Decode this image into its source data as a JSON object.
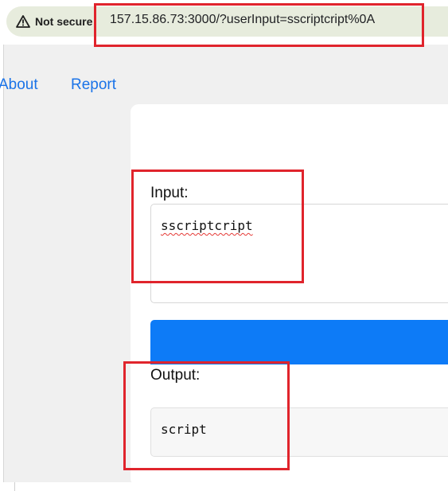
{
  "browser": {
    "security_label": "Not secure",
    "security_icon": "warning-triangle-icon",
    "url": "157.15.86.73:3000/?userInput=sscriptcript%0A"
  },
  "nav": {
    "items": [
      {
        "label": "About"
      },
      {
        "label": "Report"
      }
    ]
  },
  "form": {
    "input_label": "Input:",
    "input_value": "sscriptcript",
    "submit_label": "",
    "output_label": "Output:",
    "output_value": "script"
  },
  "colors": {
    "link": "#1a73e8",
    "button": "#0d7bf7",
    "annotation": "#e0242c",
    "omnibox": "#e7ecdd"
  }
}
